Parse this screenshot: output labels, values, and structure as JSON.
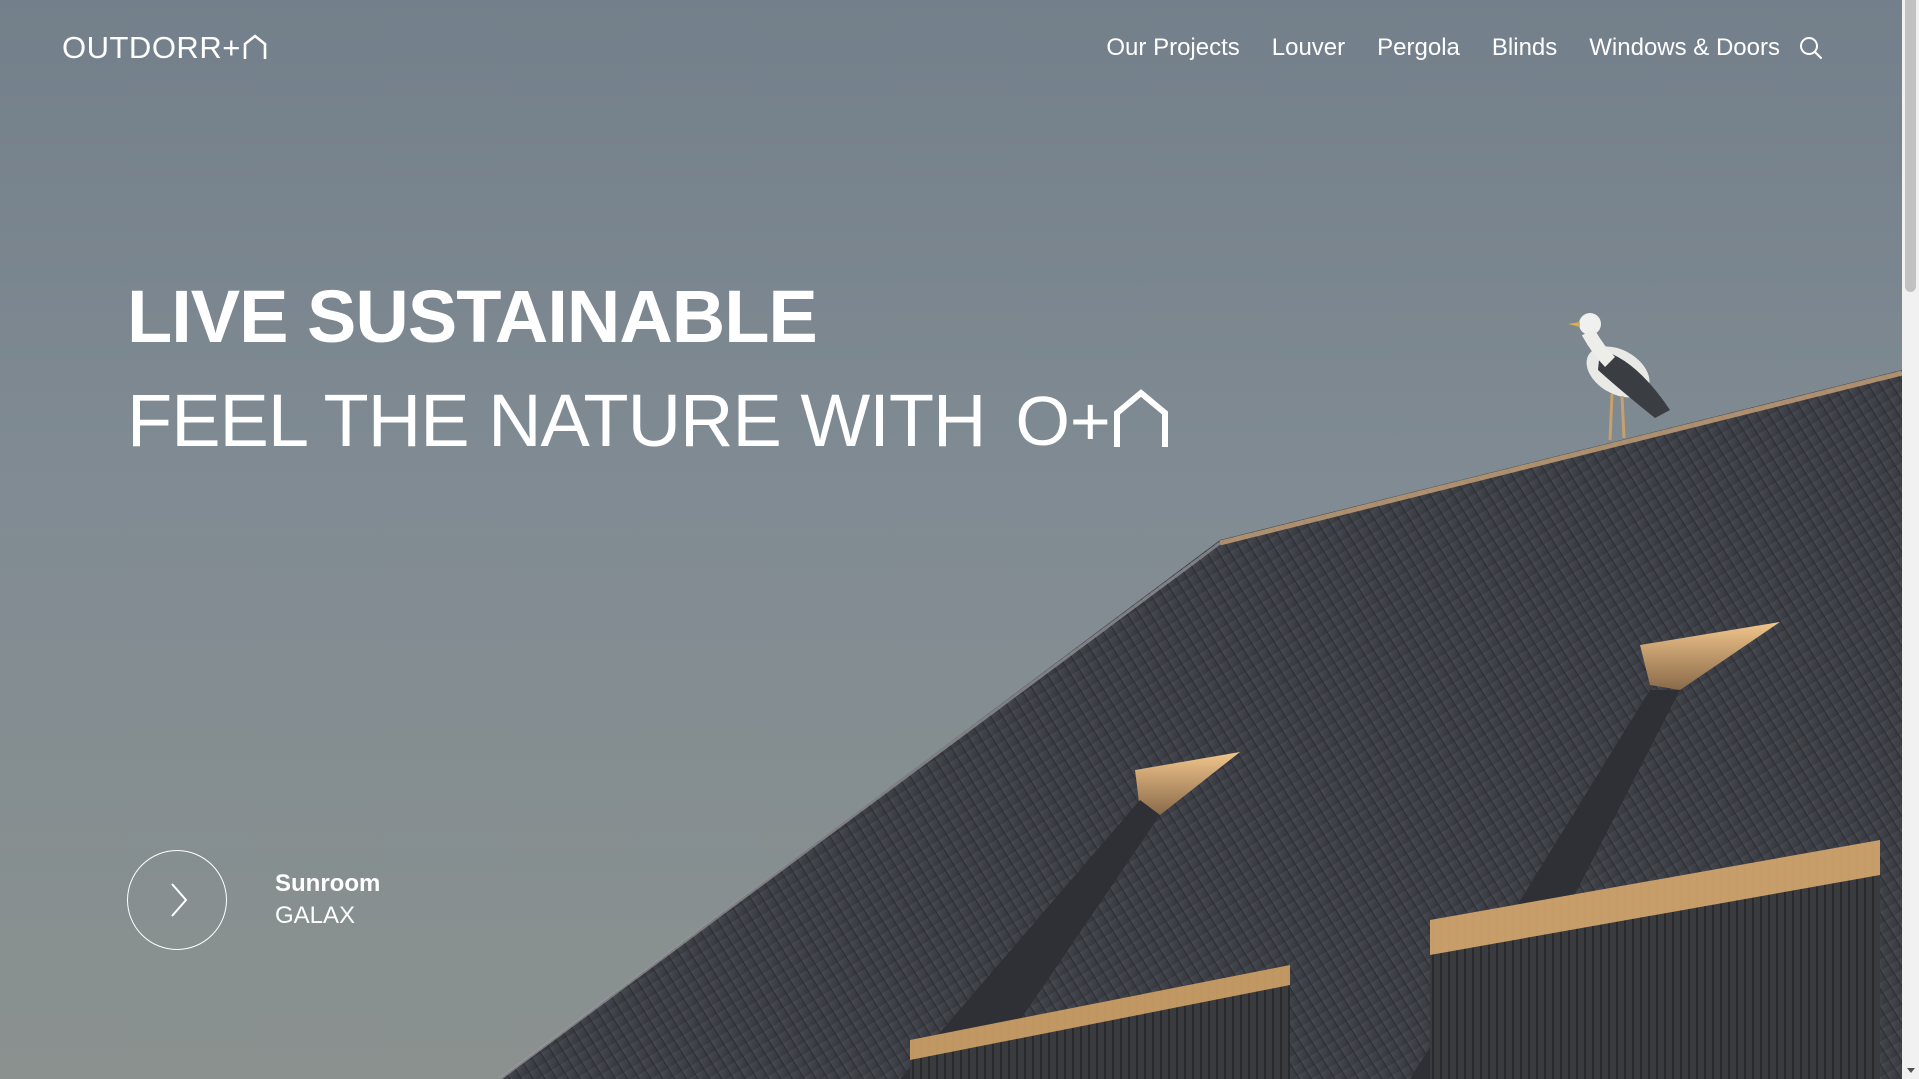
{
  "header": {
    "logo_text": "OUTDORR+",
    "nav": [
      {
        "label": "Our Projects"
      },
      {
        "label": "Louver"
      },
      {
        "label": "Pergola"
      },
      {
        "label": "Blinds"
      },
      {
        "label": "Windows & Doors"
      }
    ],
    "search_icon": "search-icon"
  },
  "hero": {
    "headline_line1": "LIVE SUSTAINABLE",
    "headline_line2": "FEEL THE NATURE WITH",
    "headline_logo_text": "O+",
    "background_image": "seagull-on-roof-sunset",
    "slide": {
      "category": "Sunroom",
      "name": "GALAX",
      "next_icon": "chevron-right-icon"
    }
  },
  "colors": {
    "sky": "#7d8891",
    "text": "#ffffff",
    "roof": "#3d3f45",
    "glow": "#e8b77a"
  }
}
